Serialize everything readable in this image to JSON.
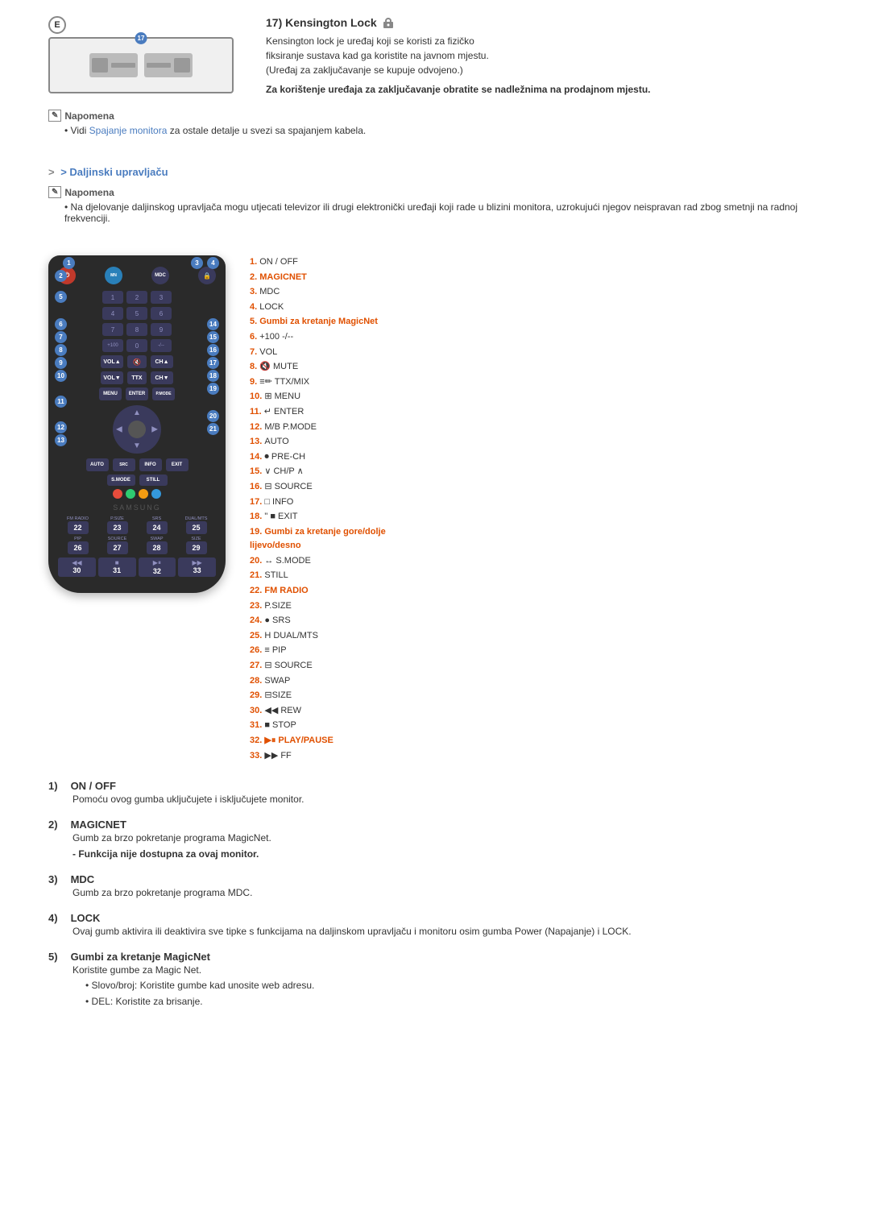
{
  "top_section": {
    "e_label": "E",
    "badge_17": "17",
    "title": "17)  Kensington Lock",
    "description_lines": [
      "Kensington lock je uređaj koji se koristi za fizičko",
      "fiksiranje sustava kad ga koristite na javnom mjestu.",
      "(Uređaj za zaključavanje se kupuje odvojeno.)"
    ],
    "bold_text": "Za korištenje uređaja za zaključavanje obratite se nadležnima na prodajnom mjestu.",
    "note_label": "Napomena",
    "note_bullet": "Vidi Spajanje monitora za ostale detalje u svezi sa spajanjem kabela.",
    "note_link_text": "Spajanje monitora"
  },
  "remote_section": {
    "nav_title": "> Daljinski upravljaču",
    "note_label": "Napomena",
    "note_text": "Na djelovanje daljinskog upravljača mogu utjecati televizor ili drugi elektronički uređaji koji rade u blizini monitora, uzrokujući njegov neispravan rad zbog smetnji na radnoj frekvenciji."
  },
  "legend": {
    "items": [
      {
        "num": "1.",
        "name": "ON / OFF",
        "bold": false
      },
      {
        "num": "2.",
        "name": "MAGICNET",
        "bold": true
      },
      {
        "num": "3.",
        "name": "MDC",
        "bold": false
      },
      {
        "num": "4.",
        "name": "LOCK",
        "bold": false
      },
      {
        "num": "5.",
        "name": "Gumbi za kretanje MagicNet",
        "bold": true
      },
      {
        "num": "6.",
        "name": "+100 -/--",
        "bold": false
      },
      {
        "num": "7.",
        "name": "VOL",
        "bold": false
      },
      {
        "num": "8.",
        "name": "🔇 MUTE",
        "bold": false
      },
      {
        "num": "9.",
        "name": "≡✏ TTX/MIX",
        "bold": false
      },
      {
        "num": "10.",
        "name": "⊞ MENU",
        "bold": false
      },
      {
        "num": "11.",
        "name": "↵ ENTER",
        "bold": false
      },
      {
        "num": "12.",
        "name": "M/B P.MODE",
        "bold": false
      },
      {
        "num": "13.",
        "name": "AUTO",
        "bold": false
      },
      {
        "num": "14.",
        "name": "⏺ PRE-CH",
        "bold": false
      },
      {
        "num": "15.",
        "name": "∨ CH/P ∧",
        "bold": false
      },
      {
        "num": "16.",
        "name": "⊟ SOURCE",
        "bold": false
      },
      {
        "num": "17.",
        "name": "□ INFO",
        "bold": false
      },
      {
        "num": "18.",
        "name": "\" ■ EXIT",
        "bold": false
      },
      {
        "num": "19.",
        "name": "Gumbi za kretanje gore/dolje lijevo/desno",
        "bold": true
      },
      {
        "num": "20.",
        "name": "↔ S.MODE",
        "bold": false
      },
      {
        "num": "21.",
        "name": "STILL",
        "bold": false
      },
      {
        "num": "22.",
        "name": "FM RADIO",
        "bold": true
      },
      {
        "num": "23.",
        "name": "P.SIZE",
        "bold": false
      },
      {
        "num": "24.",
        "name": "● SRS",
        "bold": false
      },
      {
        "num": "25.",
        "name": "H DUAL/MTS",
        "bold": false
      },
      {
        "num": "26.",
        "name": "≡ PIP",
        "bold": false
      },
      {
        "num": "27.",
        "name": "⊟ SOURCE",
        "bold": false
      },
      {
        "num": "28.",
        "name": "SWAP",
        "bold": false
      },
      {
        "num": "29.",
        "name": "⊟SIZE",
        "bold": false
      },
      {
        "num": "30.",
        "name": "◀◀ REW",
        "bold": false
      },
      {
        "num": "31.",
        "name": "■ STOP",
        "bold": false
      },
      {
        "num": "32.",
        "name": "▶⏸ PLAY/PAUSE",
        "bold": true
      },
      {
        "num": "33.",
        "name": "▶▶ FF",
        "bold": false
      }
    ]
  },
  "descriptions": [
    {
      "num": "1)",
      "title": "ON / OFF",
      "body": "Pomoću ovog gumba uključujete i isključujete monitor.",
      "sub_items": []
    },
    {
      "num": "2)",
      "title": "MAGICNET",
      "body": "Gumb za brzo pokretanje programa MagicNet.",
      "bold_body": "- Funkcija nije dostupna za ovaj monitor.",
      "sub_items": []
    },
    {
      "num": "3)",
      "title": "MDC",
      "body": "Gumb za brzo pokretanje programa MDC.",
      "sub_items": []
    },
    {
      "num": "4)",
      "title": "LOCK",
      "body": "Ovaj gumb aktivira ili deaktivira sve tipke s funkcijama na daljinskom upravljaču i monitoru osim gumba Power (Napajanje) i LOCK.",
      "sub_items": []
    },
    {
      "num": "5)",
      "title": "Gumbi za kretanje MagicNet",
      "body": "Koristite gumbe za Magic Net.",
      "sub_items": [
        "• Slovo/broj:  Koristite gumbe kad unosite web adresu.",
        "• DEL:  Koristite za brisanje."
      ]
    }
  ]
}
